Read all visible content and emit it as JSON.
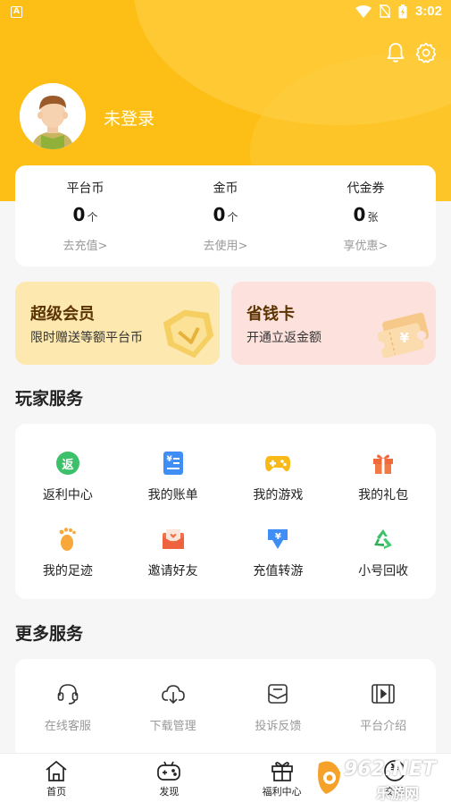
{
  "status_bar": {
    "time": "3:02",
    "app_badge": "A"
  },
  "header": {
    "login_label": "未登录"
  },
  "balances": [
    {
      "label": "平台币",
      "value": "0",
      "unit": "个",
      "link": "去充值>"
    },
    {
      "label": "金币",
      "value": "0",
      "unit": "个",
      "link": "去使用>"
    },
    {
      "label": "代金券",
      "value": "0",
      "unit": "张",
      "link": "享优惠>"
    }
  ],
  "promos": {
    "vip": {
      "title": "超级会员",
      "subtitle": "限时赠送等额平台币"
    },
    "save": {
      "title": "省钱卡",
      "subtitle": "开通立返金额",
      "symbol": "¥"
    }
  },
  "player_services": {
    "title": "玩家服务",
    "items": [
      {
        "label": "返利中心",
        "icon": "rebate-icon"
      },
      {
        "label": "我的账单",
        "icon": "bill-icon"
      },
      {
        "label": "我的游戏",
        "icon": "gamepad-icon"
      },
      {
        "label": "我的礼包",
        "icon": "gift-icon"
      },
      {
        "label": "我的足迹",
        "icon": "footprint-icon"
      },
      {
        "label": "邀请好友",
        "icon": "invite-icon"
      },
      {
        "label": "充值转游",
        "icon": "transfer-icon"
      },
      {
        "label": "小号回收",
        "icon": "recycle-icon"
      }
    ],
    "rebate_glyph": "返",
    "bill_glyph": "¥",
    "transfer_glyph": "¥"
  },
  "more_services": {
    "title": "更多服务",
    "items": [
      {
        "label": "在线客服",
        "icon": "headset-icon"
      },
      {
        "label": "下载管理",
        "icon": "download-icon"
      },
      {
        "label": "投诉反馈",
        "icon": "feedback-icon"
      },
      {
        "label": "平台介绍",
        "icon": "film-icon"
      }
    ]
  },
  "tabbar": [
    {
      "label": "首页",
      "icon": "home-icon"
    },
    {
      "label": "发现",
      "icon": "discover-icon"
    },
    {
      "label": "福利中心",
      "icon": "gift-icon"
    },
    {
      "label": "交易",
      "icon": "trade-icon"
    }
  ],
  "trade_glyph": "¥",
  "watermark": {
    "text_top": "962.NET",
    "text_bottom": "乐游网"
  },
  "colors": {
    "brand": "#fdbf16",
    "green": "#3cc06a",
    "blue": "#3f8ef5",
    "orange": "#f57a2e",
    "red": "#e8553c"
  }
}
